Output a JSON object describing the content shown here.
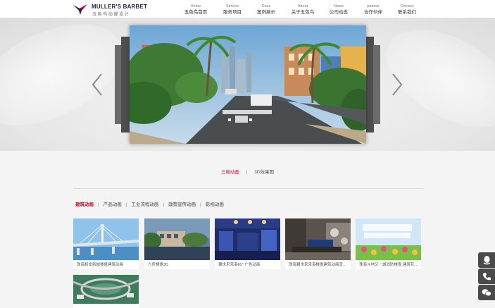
{
  "brand": {
    "name_en": "MULLER'S BARBET",
    "name_cn": "五色鸟动漫设计",
    "accent": "#c8102e"
  },
  "nav": [
    {
      "en": "Home",
      "cn": "五色鸟首页"
    },
    {
      "en": "Service",
      "cn": "服务项目"
    },
    {
      "en": "Case",
      "cn": "案例展示"
    },
    {
      "en": "About",
      "cn": "关于五色鸟"
    },
    {
      "en": "News",
      "cn": "公司动态"
    },
    {
      "en": "partner",
      "cn": "合作伙伴"
    },
    {
      "en": "Contact",
      "cn": "联系我们"
    }
  ],
  "banner": {
    "prev_icon": "chevron-left-icon",
    "next_icon": "chevron-right-icon"
  },
  "category_tabs": [
    "三维动画",
    "3D效果图"
  ],
  "active_category": 0,
  "sub_tabs": [
    "建筑动画",
    "产品动画",
    "工业流程动画",
    "政策宣传动画",
    "影视动画"
  ],
  "active_sub_tab": 0,
  "cases": [
    {
      "caption": "珠海和岸新城楼盘建筑动画"
    },
    {
      "caption": "六房楼盘3D"
    },
    {
      "caption": "翼世来来港60°  广告动画"
    },
    {
      "caption": "珠海翼世来来港楼盘建筑动画宣传片"
    },
    {
      "caption": "珠海斗地又一城消防楼盘 建筑花海..."
    },
    {
      "caption": ""
    }
  ],
  "side_tools": [
    "qq-icon",
    "phone-icon",
    "wechat-icon"
  ]
}
